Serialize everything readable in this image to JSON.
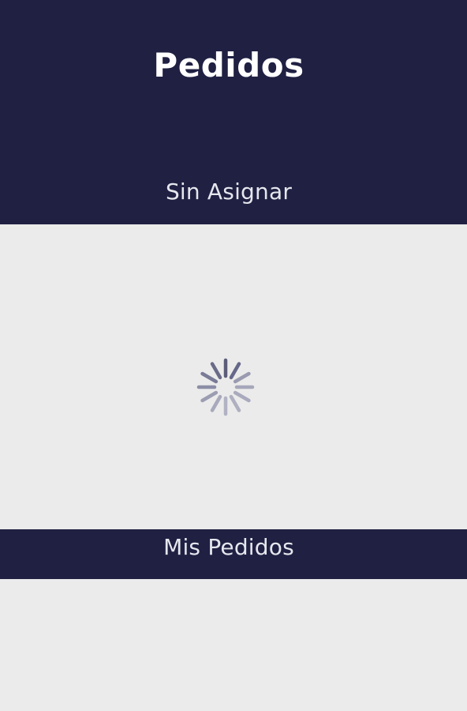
{
  "header": {
    "title": "Pedidos",
    "background_color": "#1f2042"
  },
  "sections": {
    "unassigned": {
      "label": "Sin Asignar"
    },
    "my_orders": {
      "label": "Mis Pedidos"
    }
  },
  "content": {
    "state": "loading",
    "spinner_icon": "loading-spinner-icon",
    "background_color": "#ebebeb"
  }
}
